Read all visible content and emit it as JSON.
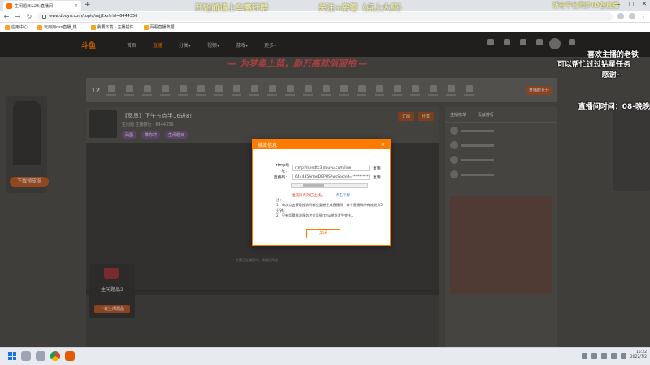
{
  "browser": {
    "tab_title": "生闲题目&25;直播间",
    "url": "www.douyu.com/topic/ssjj2xz?rid=6444356",
    "new_tab": "+",
    "win_controls": [
      "—",
      "□",
      "✕"
    ],
    "bookmarks": [
      "应用中心",
      "玩用用oss直播_热...",
      "我要下载 - 主播插件",
      "百看直播数据"
    ]
  },
  "site": {
    "logo": "斗鱼",
    "nav": [
      "首页",
      "直播",
      "分类▾",
      "视频▾",
      "游戏▾",
      "更多▾"
    ],
    "banner": "— 为梦奥上蓝，励万高就俏服拍 —",
    "room_title": "【凤凤】下午五点半16进8!",
    "room_meta": "生闲题 主播排行 · 6444356",
    "tags": [
      "凤凰",
      "带你冲",
      "生闲题目"
    ],
    "follow_buttons": [
      "订阅",
      "分享"
    ],
    "video_tip": "主播正在铺设中，请稍后再试",
    "rank_count": "12",
    "rank_pill": "开播时长分",
    "left_promo_btn": "下载领皮肤",
    "game_name": "生闲题品2",
    "game_btn": "下载生闲题品",
    "chat_tabs": [
      "主播榜单",
      "贡献排行"
    ]
  },
  "overlays": {
    "top1": "开始前请上车高钎群",
    "top2": "关注+房管（点上大师）",
    "top3": "所有平台同步ID各直播",
    "right1": "喜欢主播的老铁",
    "right2": "可以帮忙过过钻星任务",
    "right3": "感谢~",
    "right4": "直播间时间：08-晚晚"
  },
  "modal": {
    "title": "推流信息",
    "close": "✕",
    "rtmp_label": "rtmp地址：",
    "rtmp_value": "rtmp://sendtc3.douyu.com/live",
    "key_label": "直播码：",
    "key_value": "6444356rlaeDEPUS?wsSecret=***************",
    "copy": "复制",
    "warning": "推流码有效已上线。",
    "warning_link": "点击了解",
    "note": "注：\n1、每次点击获取推流码都会重新生成直播码，每个直播码的有效期为5分钟。\n2、只有切换推流服务才会导致rtmp地址发生变化。",
    "ok": "关闭"
  },
  "taskbar": {
    "time": "15:22",
    "date": "2022/7/2"
  }
}
